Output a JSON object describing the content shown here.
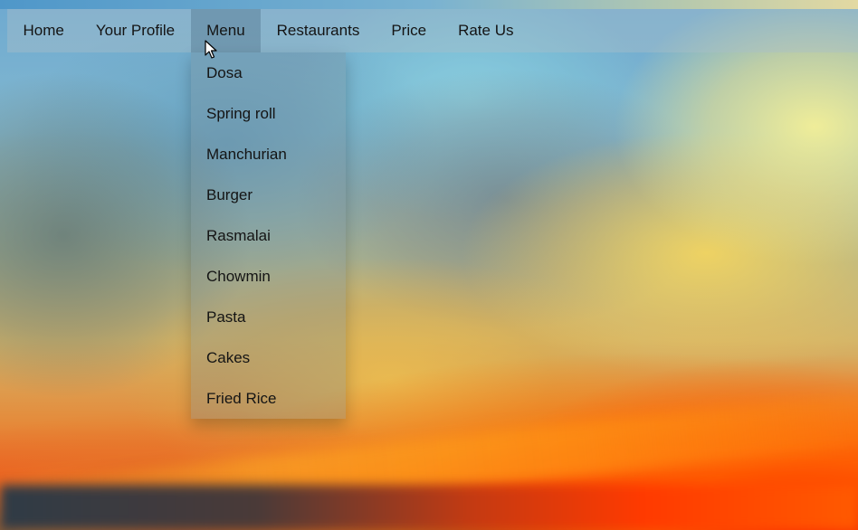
{
  "nav": {
    "items": [
      {
        "label": "Home",
        "active": false
      },
      {
        "label": "Your Profile",
        "active": false
      },
      {
        "label": "Menu",
        "active": true
      },
      {
        "label": "Restaurants",
        "active": false
      },
      {
        "label": "Price",
        "active": false
      },
      {
        "label": "Rate Us",
        "active": false
      }
    ]
  },
  "dropdown": {
    "items": [
      "Dosa",
      "Spring roll",
      "Manchurian",
      "Burger",
      "Rasmalai",
      "Chowmin",
      "Pasta",
      "Cakes",
      "Fried Rice"
    ]
  },
  "cursor": {
    "icon": "pointer-arrow-icon"
  }
}
